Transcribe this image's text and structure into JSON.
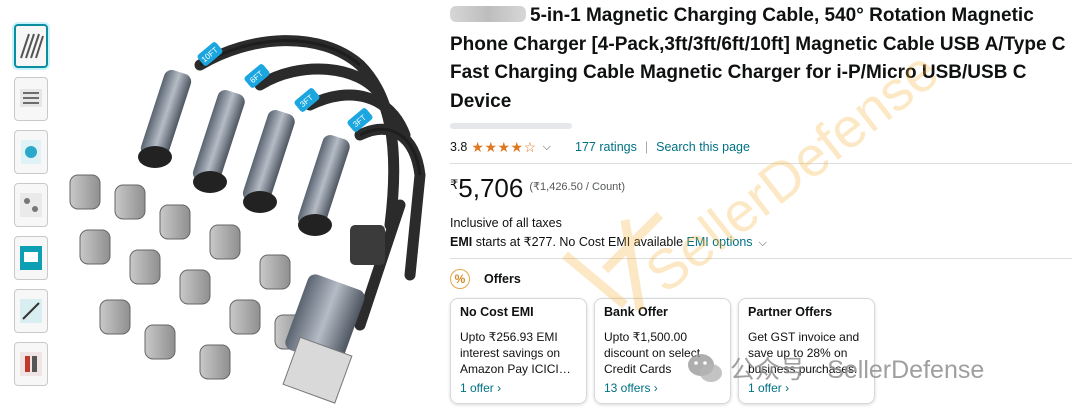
{
  "product": {
    "title": "5-in-1 Magnetic Charging Cable, 540° Rotation Magnetic Phone Charger [4-Pack,3ft/3ft/6ft/10ft] Magnetic Cable USB A/Type C Fast Charging Cable Magnetic Charger for i-P/Micro USB/USB C Device",
    "rating_value": "3.8",
    "stars_text": "★★★★☆",
    "ratings_link": "177 ratings",
    "search_link": "Search this page",
    "currency": "₹",
    "price": "5,706",
    "unit_price": "(₹1,426.50 / Count)",
    "taxes": "Inclusive of all taxes",
    "emi_label": "EMI",
    "emi_text": " starts at ₹277. No Cost EMI available ",
    "emi_link": "EMI options"
  },
  "image": {
    "cable_labels": [
      "10FT",
      "6FT",
      "3FT",
      "3FT"
    ]
  },
  "offers": {
    "heading": "Offers",
    "cards": [
      {
        "title": "No Cost EMI",
        "body": "Upto ₹256.93 EMI interest savings on Amazon Pay ICICI…",
        "link": "1 offer ›"
      },
      {
        "title": "Bank Offer",
        "body": "Upto ₹1,500.00 discount on select Credit Cards",
        "link": "13 offers ›"
      },
      {
        "title": "Partner Offers",
        "body": "Get GST invoice and save up to 28% on business purchases.",
        "link": "1 offer ›"
      }
    ]
  },
  "watermark": {
    "diagonal_text": "SellerDefense",
    "footer_text": "公众号 · SellerDefense"
  },
  "colors": {
    "link": "#007185",
    "star": "#de7921",
    "selected_thumb": "#0d8ea0",
    "watermark": "#f5b02e"
  },
  "icons": [
    "chevron-down-icon",
    "offer-percent-icon",
    "wechat-logo-icon"
  ]
}
